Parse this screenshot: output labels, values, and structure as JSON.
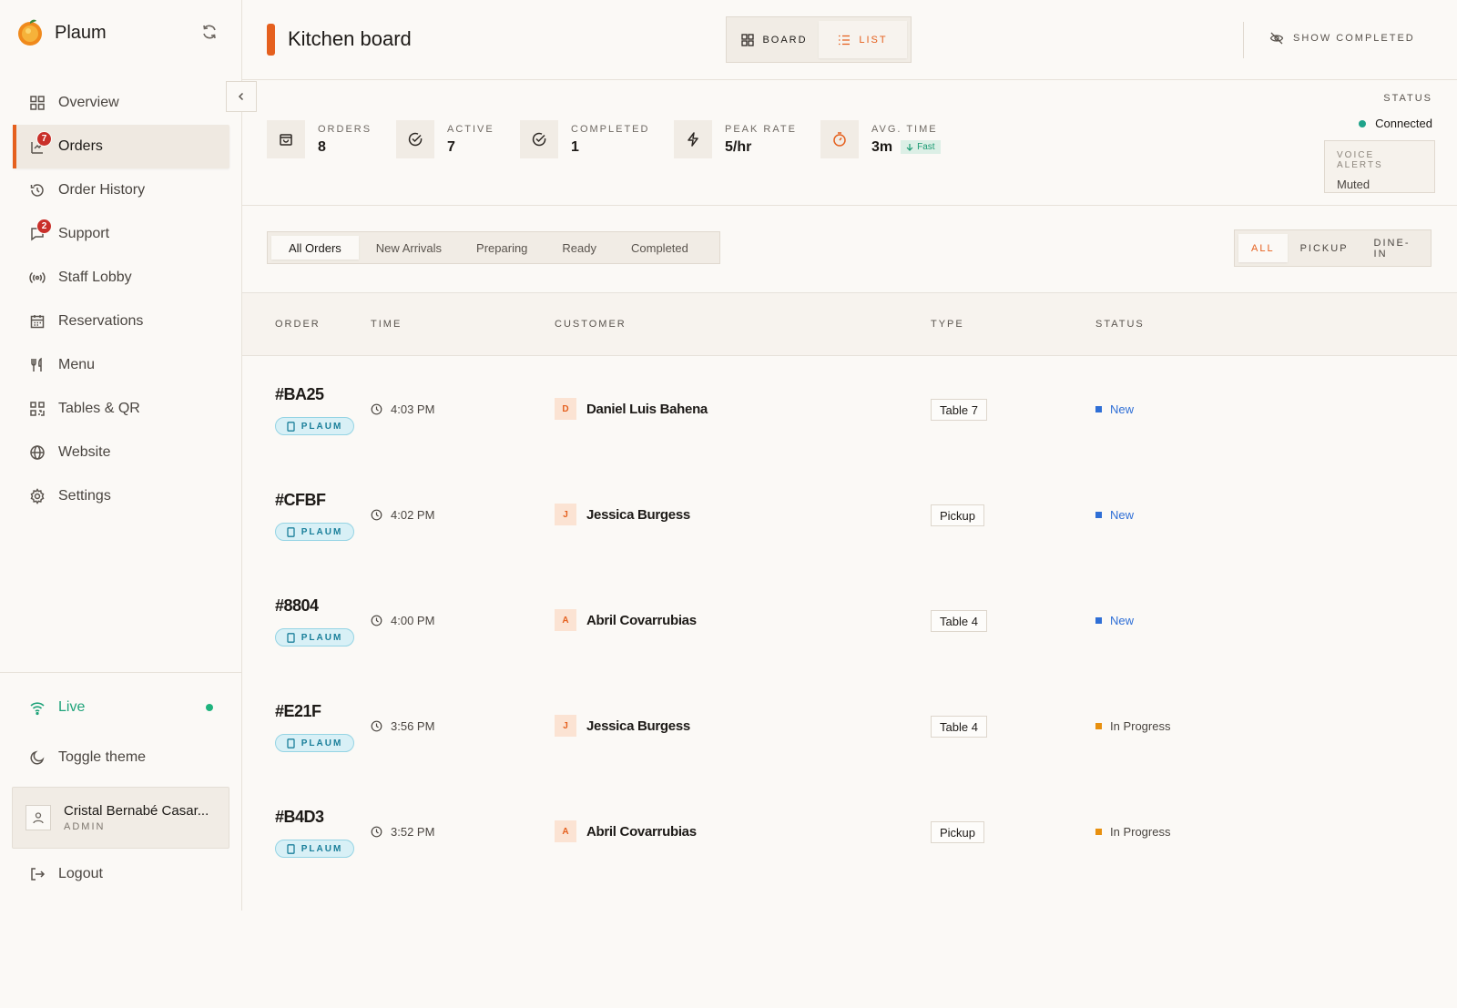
{
  "app": {
    "name": "Plaum"
  },
  "sidebar": {
    "items": [
      {
        "label": "Overview",
        "icon": "grid-icon",
        "active": false,
        "badge": ""
      },
      {
        "label": "Orders",
        "icon": "orders-icon",
        "active": true,
        "badge": "7"
      },
      {
        "label": "Order History",
        "icon": "history-icon",
        "active": false,
        "badge": ""
      },
      {
        "label": "Support",
        "icon": "chat-icon",
        "active": false,
        "badge": "2"
      },
      {
        "label": "Staff Lobby",
        "icon": "broadcast-icon",
        "active": false,
        "badge": ""
      },
      {
        "label": "Reservations",
        "icon": "calendar-icon",
        "active": false,
        "badge": ""
      },
      {
        "label": "Menu",
        "icon": "utensils-icon",
        "active": false,
        "badge": ""
      },
      {
        "label": "Tables & QR",
        "icon": "qr-icon",
        "active": false,
        "badge": ""
      },
      {
        "label": "Website",
        "icon": "globe-icon",
        "active": false,
        "badge": ""
      },
      {
        "label": "Settings",
        "icon": "gear-icon",
        "active": false,
        "badge": ""
      }
    ],
    "live_label": "Live",
    "theme_label": "Toggle theme",
    "user": {
      "name": "Cristal Bernabé Casar...",
      "role": "ADMIN"
    },
    "logout_label": "Logout"
  },
  "header": {
    "title": "Kitchen board",
    "view_board": "BOARD",
    "view_list": "LIST",
    "show_completed": "SHOW COMPLETED"
  },
  "stats": {
    "orders": {
      "label": "ORDERS",
      "value": "8"
    },
    "active": {
      "label": "ACTIVE",
      "value": "7"
    },
    "completed": {
      "label": "COMPLETED",
      "value": "1"
    },
    "peak_rate": {
      "label": "PEAK RATE",
      "value": "5/hr"
    },
    "avg_time": {
      "label": "AVG. TIME",
      "value": "3m",
      "tag": "Fast"
    },
    "status": {
      "label": "STATUS",
      "value": "Connected"
    },
    "voice_alerts": {
      "label": "VOICE ALERTS",
      "value": "Muted"
    }
  },
  "filters": {
    "tabs": [
      "All Orders",
      "New Arrivals",
      "Preparing",
      "Ready",
      "Completed"
    ],
    "active_tab": "All Orders",
    "types": [
      "ALL",
      "PICKUP",
      "DINE-IN"
    ],
    "active_type": "ALL"
  },
  "table": {
    "headers": {
      "order": "ORDER",
      "time": "TIME",
      "customer": "CUSTOMER",
      "type": "TYPE",
      "status": "STATUS"
    },
    "rows": [
      {
        "id": "#BA25",
        "source": "PLAUM",
        "time": "4:03 PM",
        "initial": "D",
        "customer": "Daniel Luis Bahena",
        "type": "Table 7",
        "status": "New"
      },
      {
        "id": "#CFBF",
        "source": "PLAUM",
        "time": "4:02 PM",
        "initial": "J",
        "customer": "Jessica Burgess",
        "type": "Pickup",
        "status": "New"
      },
      {
        "id": "#8804",
        "source": "PLAUM",
        "time": "4:00 PM",
        "initial": "A",
        "customer": "Abril Covarrubias",
        "type": "Table 4",
        "status": "New"
      },
      {
        "id": "#E21F",
        "source": "PLAUM",
        "time": "3:56 PM",
        "initial": "J",
        "customer": "Jessica Burgess",
        "type": "Table 4",
        "status": "In Progress"
      },
      {
        "id": "#B4D3",
        "source": "PLAUM",
        "time": "3:52 PM",
        "initial": "A",
        "customer": "Abril Covarrubias",
        "type": "Pickup",
        "status": "In Progress"
      }
    ]
  },
  "colors": {
    "accent": "#e5601e",
    "new_status": "#2f6fd6",
    "in_progress_status": "#e8900f",
    "live": "#1fa37a"
  }
}
